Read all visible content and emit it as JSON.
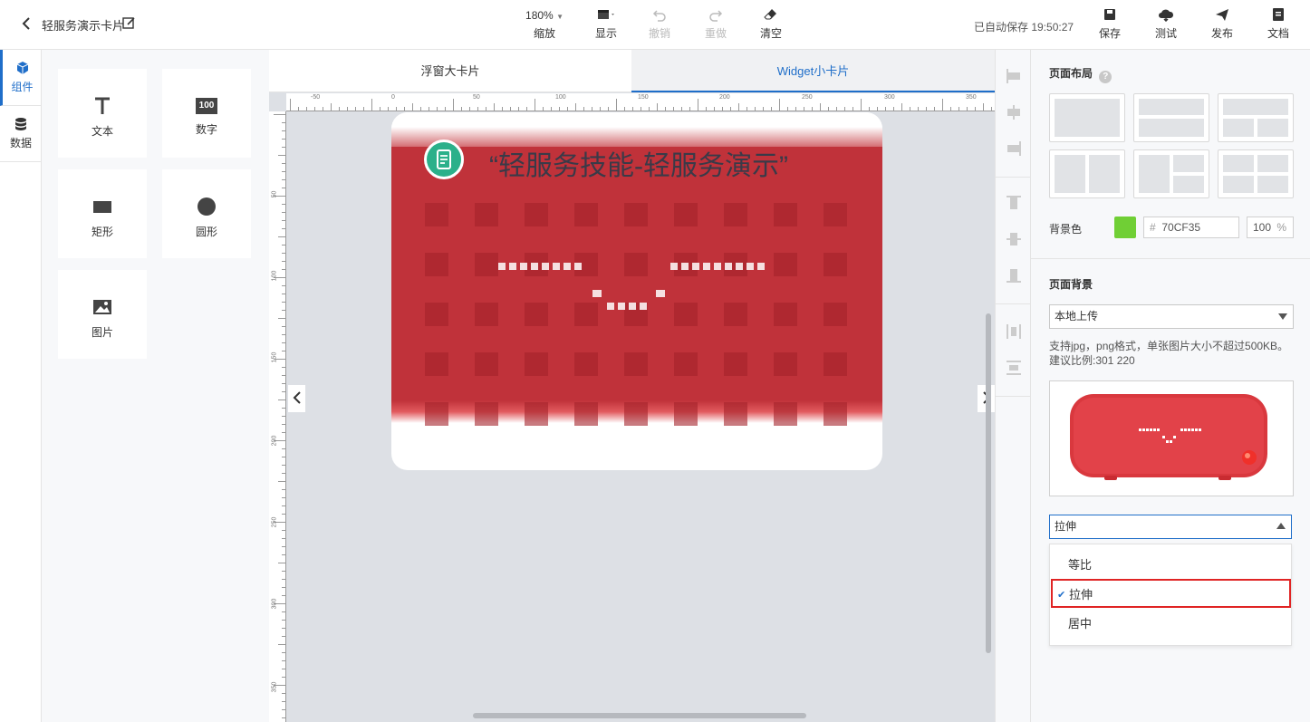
{
  "header": {
    "title": "轻服务演示卡片",
    "zoom_value": "180%",
    "zoom_label": "缩放",
    "display_label": "显示",
    "undo_label": "撤销",
    "redo_label": "重做",
    "clear_label": "清空",
    "autosave_text": "已自动保存 19:50:27",
    "save_label": "保存",
    "test_label": "测试",
    "publish_label": "发布",
    "docs_label": "文档"
  },
  "leftnav": {
    "items": [
      {
        "label": "组件",
        "icon": "cube-icon"
      },
      {
        "label": "数据",
        "icon": "database-icon"
      }
    ]
  },
  "components": {
    "items": [
      {
        "label": "文本",
        "icon": "text-icon"
      },
      {
        "label": "数字",
        "icon": "number-icon",
        "badge": "100"
      },
      {
        "label": "矩形",
        "icon": "rectangle-icon"
      },
      {
        "label": "圆形",
        "icon": "circle-icon"
      },
      {
        "label": "图片",
        "icon": "image-icon"
      }
    ]
  },
  "canvas": {
    "tabs": [
      {
        "label": "浮窗大卡片"
      },
      {
        "label": "Widget小卡片"
      }
    ],
    "ruler_top": [
      "-50",
      "0",
      "50",
      "100",
      "150",
      "200",
      "250",
      "300",
      "350"
    ],
    "ruler_left": [
      "50",
      "100",
      "150",
      "200",
      "250",
      "300",
      "350"
    ],
    "widget_title": "“轻服务技能-轻服务演示”"
  },
  "props": {
    "layout_title": "页面布局",
    "bg_color_label": "背景色",
    "bg_color_value": "70CF35",
    "bg_color_hash": "#",
    "bg_color_swatch": "#70CF35",
    "opacity_value": "100",
    "opacity_unit": "%",
    "bg_title": "页面背景",
    "source_select": "本地上传",
    "help_line1": "支持jpg，png格式，单张图片大小不超过500KB。",
    "help_line2": "建议比例:301 220",
    "fit_select": "拉伸",
    "fit_options": [
      "等比",
      "拉伸",
      "居中"
    ]
  },
  "colors": {
    "accent": "#1f6ec9",
    "widget_red": "#c0323a",
    "selection_border": "#e02424"
  }
}
